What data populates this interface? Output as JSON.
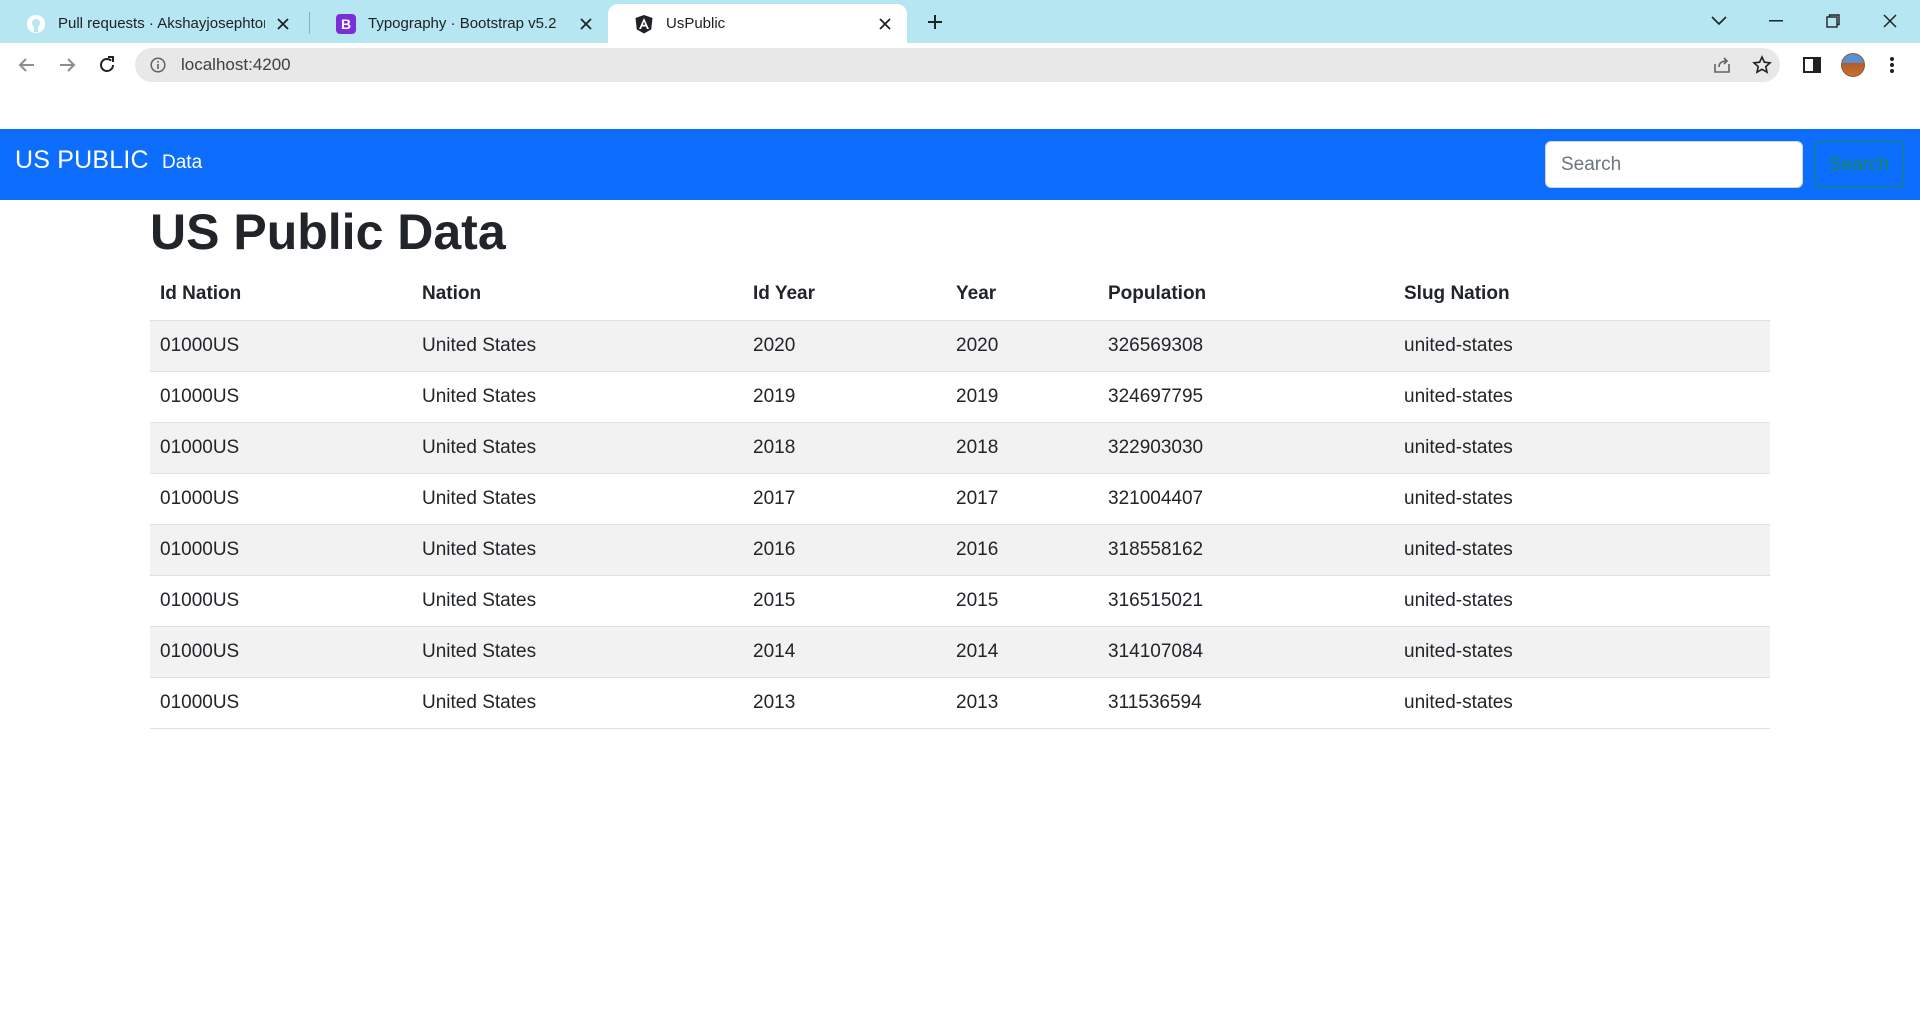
{
  "browser": {
    "tabs": [
      {
        "label": "Pull requests · Akshayjosephtomy",
        "icon": "github-icon",
        "active": false
      },
      {
        "label": "Typography · Bootstrap v5.2",
        "icon": "bootstrap-icon",
        "active": false
      },
      {
        "label": "UsPublic",
        "icon": "angular-icon",
        "active": true
      }
    ],
    "url": "localhost:4200"
  },
  "navbar": {
    "brand": "US PUBLIC",
    "link": "Data",
    "search_placeholder": "Search",
    "search_button": "Search",
    "color": "#0d6efd"
  },
  "main": {
    "title": "US Public Data",
    "table": {
      "headers": [
        "Id Nation",
        "Nation",
        "Id Year",
        "Year",
        "Population",
        "Slug Nation"
      ],
      "rows": [
        [
          "01000US",
          "United States",
          "2020",
          "2020",
          "326569308",
          "united-states"
        ],
        [
          "01000US",
          "United States",
          "2019",
          "2019",
          "324697795",
          "united-states"
        ],
        [
          "01000US",
          "United States",
          "2018",
          "2018",
          "322903030",
          "united-states"
        ],
        [
          "01000US",
          "United States",
          "2017",
          "2017",
          "321004407",
          "united-states"
        ],
        [
          "01000US",
          "United States",
          "2016",
          "2016",
          "318558162",
          "united-states"
        ],
        [
          "01000US",
          "United States",
          "2015",
          "2015",
          "316515021",
          "united-states"
        ],
        [
          "01000US",
          "United States",
          "2014",
          "2014",
          "314107084",
          "united-states"
        ],
        [
          "01000US",
          "United States",
          "2013",
          "2013",
          "311536594",
          "united-states"
        ]
      ]
    }
  }
}
